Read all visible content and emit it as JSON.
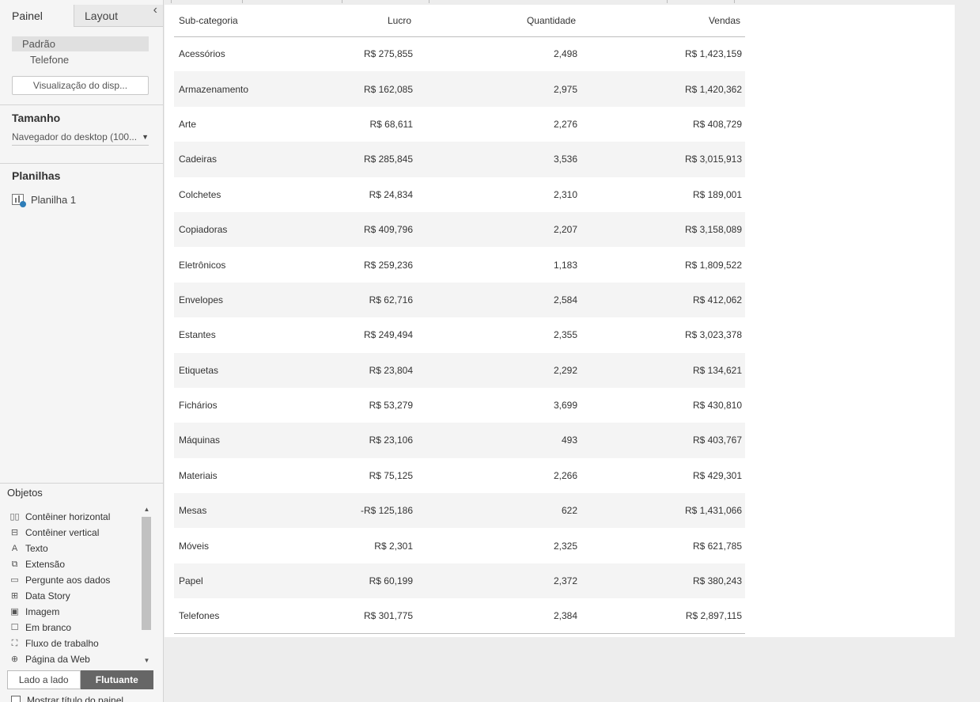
{
  "panel": {
    "tabs": {
      "active": "Painel",
      "inactive": "Layout"
    },
    "devices": [
      "Padrão",
      "Telefone"
    ],
    "preview_button": "Visualização do disp...",
    "size": {
      "title": "Tamanho",
      "value": "Navegador do desktop (100..."
    },
    "sheets": {
      "title": "Planilhas",
      "items": [
        "Planilha 1"
      ]
    },
    "objects": {
      "title": "Objetos",
      "items": [
        {
          "label": "Contêiner horizontal",
          "icon": "horizontal-container-icon"
        },
        {
          "label": "Contêiner vertical",
          "icon": "vertical-container-icon"
        },
        {
          "label": "Texto",
          "icon": "text-icon"
        },
        {
          "label": "Extensão",
          "icon": "extension-icon"
        },
        {
          "label": "Pergunte aos dados",
          "icon": "ask-data-icon"
        },
        {
          "label": "Data Story",
          "icon": "data-story-icon"
        },
        {
          "label": "Imagem",
          "icon": "image-icon"
        },
        {
          "label": "Em branco",
          "icon": "blank-icon"
        },
        {
          "label": "Fluxo de trabalho",
          "icon": "workflow-icon"
        },
        {
          "label": "Página da Web",
          "icon": "web-page-icon"
        }
      ]
    },
    "layout_toggle": {
      "tiled": "Lado a lado",
      "floating": "Flutuante",
      "selected": "Flutuante"
    },
    "show_title": {
      "label": "Mostrar título do painel",
      "checked": false
    }
  },
  "table": {
    "headers": {
      "subcategory": "Sub-categoria",
      "profit": "Lucro",
      "quantity": "Quantidade",
      "sales": "Vendas"
    },
    "rows": [
      [
        "Acessórios",
        "R$ 275,855",
        "2,498",
        "R$ 1,423,159"
      ],
      [
        "Armazenamento",
        "R$ 162,085",
        "2,975",
        "R$ 1,420,362"
      ],
      [
        "Arte",
        "R$ 68,611",
        "2,276",
        "R$ 408,729"
      ],
      [
        "Cadeiras",
        "R$ 285,845",
        "3,536",
        "R$ 3,015,913"
      ],
      [
        "Colchetes",
        "R$ 24,834",
        "2,310",
        "R$ 189,001"
      ],
      [
        "Copiadoras",
        "R$ 409,796",
        "2,207",
        "R$ 3,158,089"
      ],
      [
        "Eletrônicos",
        "R$ 259,236",
        "1,183",
        "R$ 1,809,522"
      ],
      [
        "Envelopes",
        "R$ 62,716",
        "2,584",
        "R$ 412,062"
      ],
      [
        "Estantes",
        "R$ 249,494",
        "2,355",
        "R$ 3,023,378"
      ],
      [
        "Etiquetas",
        "R$ 23,804",
        "2,292",
        "R$ 134,621"
      ],
      [
        "Fichários",
        "R$ 53,279",
        "3,699",
        "R$ 430,810"
      ],
      [
        "Máquinas",
        "R$ 23,106",
        "493",
        "R$ 403,767"
      ],
      [
        "Materiais",
        "R$ 75,125",
        "2,266",
        "R$ 429,301"
      ],
      [
        "Mesas",
        "-R$ 125,186",
        "622",
        "R$ 1,431,066"
      ],
      [
        "Móveis",
        "R$ 2,301",
        "2,325",
        "R$ 621,785"
      ],
      [
        "Papel",
        "R$ 60,199",
        "2,372",
        "R$ 380,243"
      ],
      [
        "Telefones",
        "R$ 301,775",
        "2,384",
        "R$ 2,897,115"
      ]
    ]
  }
}
